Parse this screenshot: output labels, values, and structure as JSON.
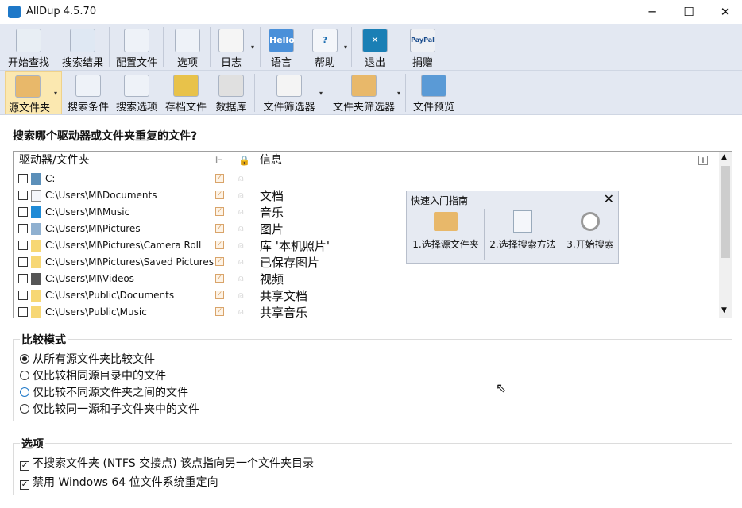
{
  "window": {
    "title": "AllDup 4.5.70",
    "minimize": "─",
    "maximize": "☐",
    "close": "✕"
  },
  "toolbar1": [
    {
      "label": "开始查找",
      "icon": "magnifier-icon"
    },
    {
      "label": "搜索结果",
      "icon": "save-results-icon"
    },
    {
      "label": "配置文件",
      "icon": "config-file-icon"
    },
    {
      "label": "选项",
      "icon": "options-icon"
    },
    {
      "label": "日志",
      "icon": "log-icon"
    },
    {
      "label": "语言",
      "icon": "language-icon",
      "badge": "Hello"
    },
    {
      "label": "帮助",
      "icon": "help-icon",
      "badge": "?"
    },
    {
      "label": "退出",
      "icon": "exit-icon",
      "badge": "✕"
    },
    {
      "label": "捐赠",
      "icon": "paypal-icon",
      "badge": "PayPal"
    }
  ],
  "toolbar2": [
    {
      "label": "源文件夹",
      "icon": "source-folder-icon"
    },
    {
      "label": "搜索条件",
      "icon": "search-criteria-icon"
    },
    {
      "label": "搜索选项",
      "icon": "search-options-icon"
    },
    {
      "label": "存档文件",
      "icon": "archive-icon"
    },
    {
      "label": "数据库",
      "icon": "database-icon"
    },
    {
      "label": "文件筛选器",
      "icon": "file-filter-icon"
    },
    {
      "label": "文件夹筛选器",
      "icon": "folder-filter-icon"
    },
    {
      "label": "文件预览",
      "icon": "file-preview-icon"
    }
  ],
  "heading": "搜索哪个驱动器或文件夹重复的文件?",
  "list": {
    "headers": {
      "folder": "驱动器/文件夹",
      "info": "信息",
      "add": "+"
    },
    "rows": [
      {
        "path": "C:",
        "info": "",
        "icon": "drive"
      },
      {
        "path": "C:\\Users\\MI\\Documents",
        "info": "文档",
        "icon": "document"
      },
      {
        "path": "C:\\Users\\MI\\Music",
        "info": "音乐",
        "icon": "music"
      },
      {
        "path": "C:\\Users\\MI\\Pictures",
        "info": "图片",
        "icon": "picture"
      },
      {
        "path": "C:\\Users\\MI\\Pictures\\Camera Roll",
        "info": "库 '本机照片'",
        "icon": "folder"
      },
      {
        "path": "C:\\Users\\MI\\Pictures\\Saved Pictures",
        "info": "已保存图片",
        "icon": "folder"
      },
      {
        "path": "C:\\Users\\MI\\Videos",
        "info": "视频",
        "icon": "video"
      },
      {
        "path": "C:\\Users\\Public\\Documents",
        "info": "共享文档",
        "icon": "folder"
      },
      {
        "path": "C:\\Users\\Public\\Music",
        "info": "共享音乐",
        "icon": "folder"
      }
    ]
  },
  "quickstart": {
    "title": "快速入门指南",
    "close": "✕",
    "steps": [
      "1.选择源文件夹",
      "2.选择搜索方法",
      "3.开始搜索"
    ]
  },
  "compare": {
    "title": "比较模式",
    "options": [
      "从所有源文件夹比较文件",
      "仅比较相同源目录中的文件",
      "仅比较不同源文件夹之间的文件",
      "仅比较同一源和子文件夹中的文件"
    ],
    "selected": 0
  },
  "options": {
    "title": "选项",
    "items": [
      {
        "label": "不搜索文件夹 (NTFS 交接点) 该点指向另一个文件夹目录",
        "checked": true
      },
      {
        "label": "禁用 Windows 64 位文件系统重定向",
        "checked": true
      }
    ]
  }
}
